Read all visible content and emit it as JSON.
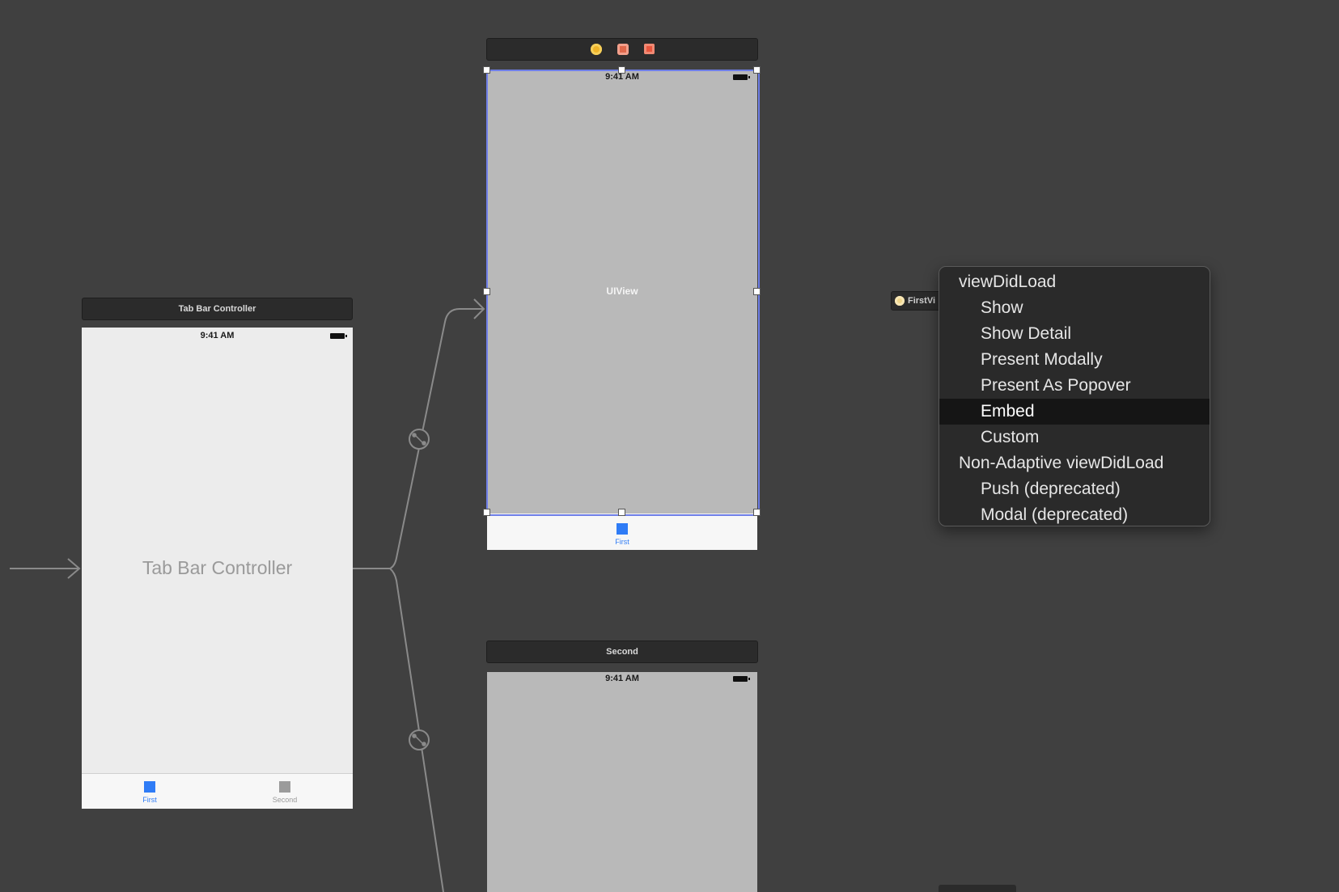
{
  "tab_bar_scene": {
    "title": "Tab Bar Controller",
    "status_time": "9:41 AM",
    "center_label": "Tab Bar Controller",
    "tabs": [
      {
        "label": "First",
        "color": "#2f7cf6"
      },
      {
        "label": "Second",
        "color": "#9b9b9b"
      }
    ]
  },
  "first_scene": {
    "status_time": "9:41 AM",
    "view_label": "UIView",
    "tab_label": "First",
    "scene_dock_icons": [
      "view-controller-icon",
      "first-responder-icon",
      "exit-icon"
    ]
  },
  "second_scene": {
    "title": "Second",
    "status_time": "9:41 AM"
  },
  "firstvc_tag": {
    "label": "FirstVi"
  },
  "segue_menu": {
    "items": [
      {
        "label": "viewDidLoad",
        "type": "header"
      },
      {
        "label": "Show",
        "type": "item"
      },
      {
        "label": "Show Detail",
        "type": "item"
      },
      {
        "label": "Present Modally",
        "type": "item"
      },
      {
        "label": "Present As Popover",
        "type": "item"
      },
      {
        "label": "Embed",
        "type": "item",
        "selected": true
      },
      {
        "label": "Custom",
        "type": "item"
      },
      {
        "label": "Non-Adaptive viewDidLoad",
        "type": "header"
      },
      {
        "label": "Push (deprecated)",
        "type": "item"
      },
      {
        "label": "Modal (deprecated)",
        "type": "item"
      }
    ]
  },
  "colors": {
    "canvas": "#404040",
    "accent_blue": "#2f7cf6",
    "selection_outline": "#6f7fe8",
    "scene_gray": "#b9b9b9",
    "tab_bar_scene_bg": "#ececec"
  }
}
